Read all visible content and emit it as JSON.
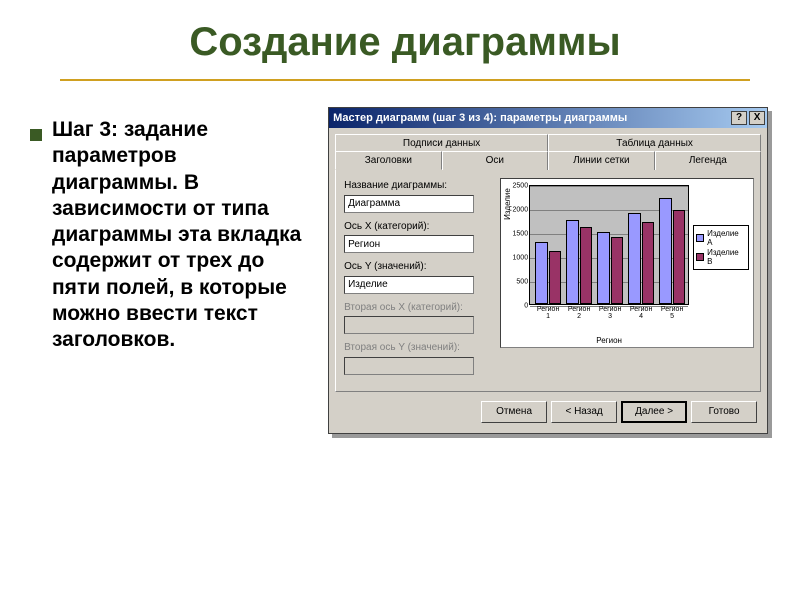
{
  "slide": {
    "title": "Создание диаграммы",
    "body": "Шаг 3: задание параметров диаграммы. В зависимости от типа диаграммы эта вкладка содержит от трех до пяти полей, в которые можно ввести текст заголовков."
  },
  "dialog": {
    "title": "Мастер диаграмм (шаг 3 из 4): параметры диаграммы",
    "help_btn": "?",
    "close_btn": "X",
    "tabs_back": [
      "Подписи данных",
      "Таблица данных"
    ],
    "tabs_front": [
      "Заголовки",
      "Оси",
      "Линии сетки",
      "Легенда"
    ],
    "active_tab": "Заголовки",
    "fields": {
      "chart_title_label": "Название диаграммы:",
      "chart_title_value": "Диаграмма",
      "x_axis_label": "Ось X (категорий):",
      "x_axis_value": "Регион",
      "y_axis_label": "Ось Y (значений):",
      "y_axis_value": "Изделие",
      "x2_axis_label": "Вторая ось X (категорий):",
      "x2_axis_value": "",
      "y2_axis_label": "Вторая ось Y (значений):",
      "y2_axis_value": ""
    },
    "buttons": {
      "cancel": "Отмена",
      "back": "< Назад",
      "next": "Далее >",
      "finish": "Готово"
    }
  },
  "chart_data": {
    "type": "bar",
    "title": "Диаграмма",
    "xlabel": "Регион",
    "ylabel": "Изделие",
    "ylim": [
      0,
      2500
    ],
    "yticks": [
      0,
      500,
      1000,
      1500,
      2000,
      2500
    ],
    "categories": [
      "Регион 1",
      "Регион 2",
      "Регион 3",
      "Регион 4",
      "Регион 5"
    ],
    "series": [
      {
        "name": "Изделие А",
        "color": "#9999ff",
        "values": [
          1300,
          1750,
          1500,
          1900,
          2200
        ]
      },
      {
        "name": "Изделие В",
        "color": "#993366",
        "values": [
          1100,
          1600,
          1400,
          1700,
          1950
        ]
      }
    ],
    "legend_position": "right"
  }
}
